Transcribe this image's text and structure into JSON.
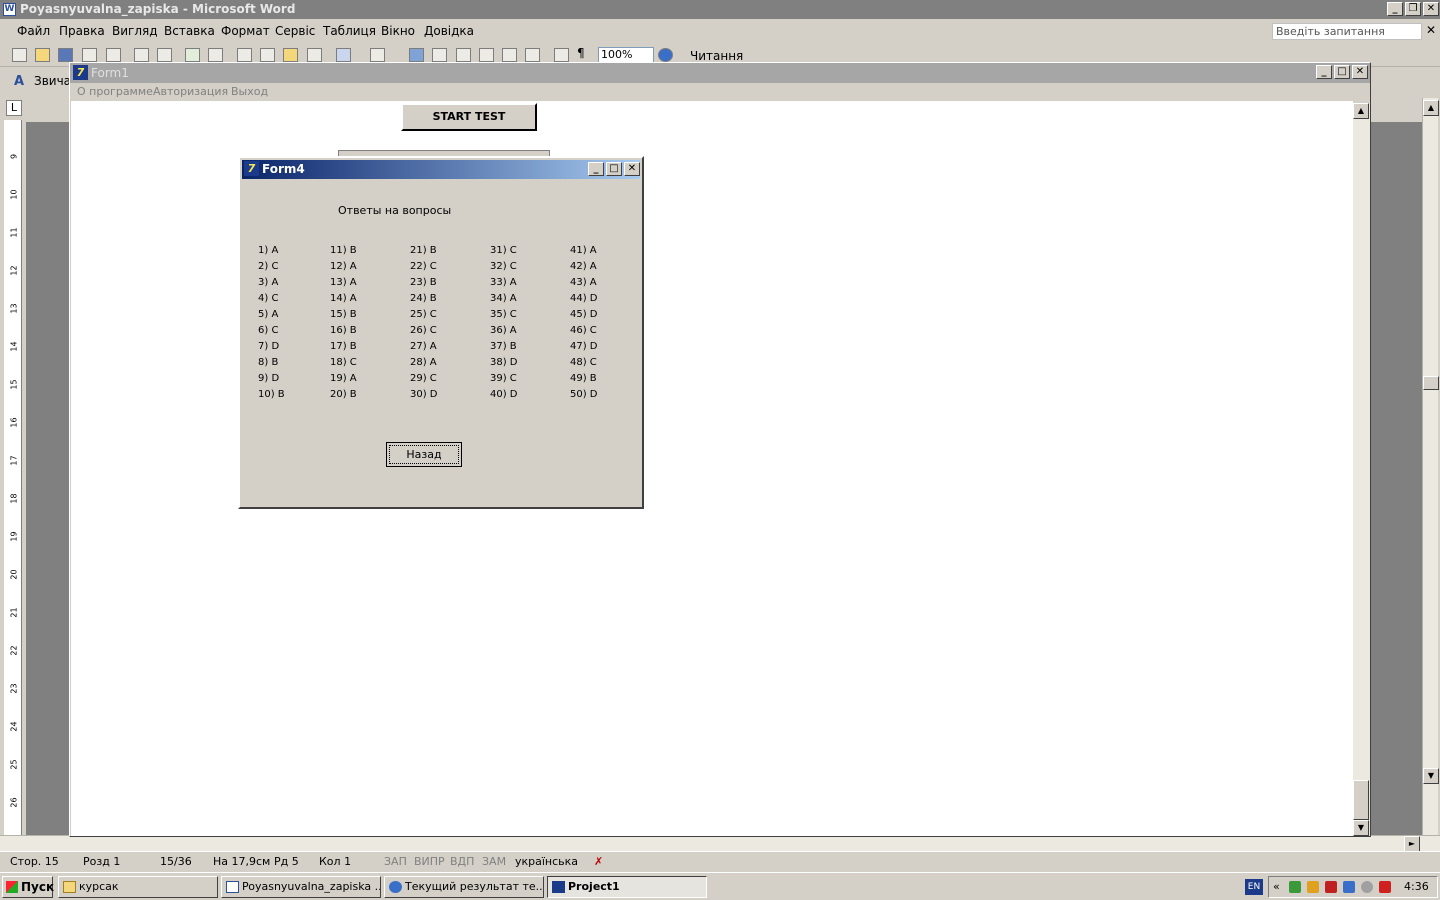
{
  "word": {
    "title": "Poyasnyuvalna_zapiska - Microsoft Word",
    "app_icon_letter": "W",
    "menu": [
      "Файл",
      "Правка",
      "Вигляд",
      "Вставка",
      "Формат",
      "Сервіс",
      "Таблиця",
      "Вікно",
      "Довідка"
    ],
    "ask_placeholder": "Введіть запитання",
    "zoom": "100%",
    "reading": "Читання",
    "style_value": "Звича",
    "ruler_numbers": [
      "9",
      "10",
      "11",
      "12",
      "13",
      "14",
      "15",
      "16",
      "17",
      "18",
      "19",
      "20",
      "21",
      "22",
      "23",
      "24",
      "25",
      "26"
    ],
    "status": {
      "page": "Стор. 15",
      "section": "Розд 1",
      "pages": "15/36",
      "at": "На 17,9см",
      "line": "Рд 5",
      "col": "Кол 1",
      "rec": "ЗАП",
      "trk": "ВИПР",
      "ext": "ВДП",
      "ovr": "ЗАМ",
      "language": "українська"
    }
  },
  "form1": {
    "title": "Form1",
    "menu": [
      "О программе",
      "Авторизация",
      "Выход"
    ],
    "start_button": "START TEST"
  },
  "form4": {
    "title": "Form4",
    "heading": "Ответы на вопросы",
    "answers": [
      [
        "1) A",
        "2) C",
        "3) A",
        "4) C",
        "5) A",
        "6) C",
        "7) D",
        "8) B",
        "9) D",
        "10) B"
      ],
      [
        "11) B",
        "12) A",
        "13) A",
        "14) A",
        "15) B",
        "16) B",
        "17) B",
        "18) C",
        "19) A",
        "20) B"
      ],
      [
        "21) B",
        "22) C",
        "23) B",
        "24) B",
        "25) C",
        "26) C",
        "27) A",
        "28) A",
        "29) C",
        "30) D"
      ],
      [
        "31) C",
        "32) C",
        "33) A",
        "34) A",
        "35) C",
        "36) A",
        "37) B",
        "38) D",
        "39) C",
        "40) D"
      ],
      [
        "41) A",
        "42) A",
        "43) A",
        "44) D",
        "45) D",
        "46) C",
        "47) D",
        "48) C",
        "49) B",
        "50) D"
      ]
    ],
    "back_button": "Назад"
  },
  "taskbar": {
    "start": "Пуск",
    "tasks": [
      "курсак",
      "Poyasnyuvalna_zapiska ...",
      "Текущий результат те...",
      "Project1"
    ],
    "language": "EN",
    "clock": "4:36"
  },
  "colors": {
    "active_title_start": "#0a246a",
    "active_title_end": "#a6caf0",
    "inactive_title": "#a6a6a6",
    "face": "#d4d0c8"
  }
}
